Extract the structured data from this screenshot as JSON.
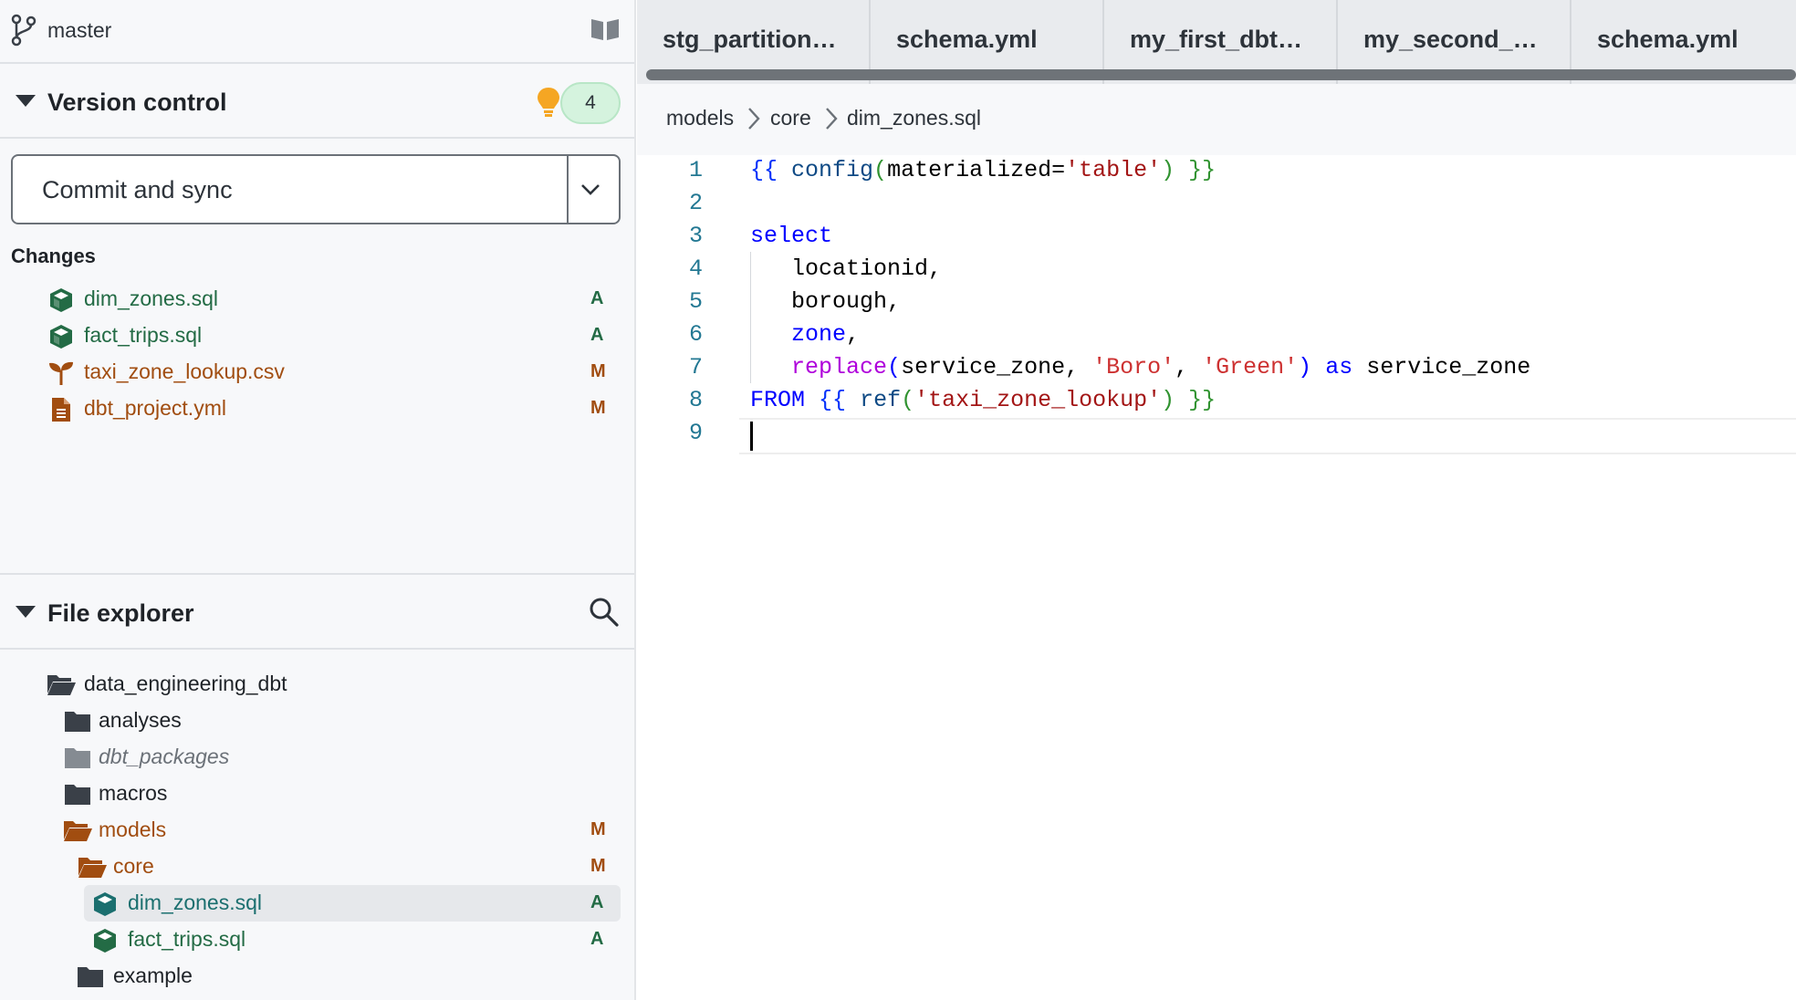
{
  "branch": {
    "name": "master",
    "icon": "git-branch-icon",
    "docs_icon": "book-icon"
  },
  "version_control": {
    "title": "Version control",
    "badge_icon": "lightbulb-icon",
    "badge_count": "4",
    "commit_button": "Commit and sync",
    "changes_label": "Changes",
    "changes": [
      {
        "name": "dim_zones.sql",
        "status": "A",
        "icon": "cube-icon"
      },
      {
        "name": "fact_trips.sql",
        "status": "A",
        "icon": "cube-icon"
      },
      {
        "name": "taxi_zone_lookup.csv",
        "status": "M",
        "icon": "seed-icon"
      },
      {
        "name": "dbt_project.yml",
        "status": "M",
        "icon": "file-icon"
      }
    ]
  },
  "file_explorer": {
    "title": "File explorer",
    "items": [
      {
        "name": "data_engineering_dbt",
        "status": "",
        "icon": "folder-open-icon"
      },
      {
        "name": "analyses",
        "status": "",
        "icon": "folder-icon"
      },
      {
        "name": "dbt_packages",
        "status": "",
        "icon": "folder-icon"
      },
      {
        "name": "macros",
        "status": "",
        "icon": "folder-icon"
      },
      {
        "name": "models",
        "status": "M",
        "icon": "folder-open-icon"
      },
      {
        "name": "core",
        "status": "M",
        "icon": "folder-open-icon"
      },
      {
        "name": "dim_zones.sql",
        "status": "A",
        "icon": "cube-icon"
      },
      {
        "name": "fact_trips.sql",
        "status": "A",
        "icon": "cube-icon"
      },
      {
        "name": "example",
        "status": "",
        "icon": "folder-icon"
      }
    ]
  },
  "tabs": [
    {
      "label": "stg_partition…"
    },
    {
      "label": "schema.yml"
    },
    {
      "label": "my_first_dbt…"
    },
    {
      "label": "my_second_…"
    },
    {
      "label": "schema.yml"
    }
  ],
  "breadcrumb": [
    "models",
    "core",
    "dim_zones.sql"
  ],
  "code": {
    "line_numbers": [
      "1",
      "2",
      "3",
      "4",
      "5",
      "6",
      "7",
      "8",
      "9"
    ],
    "tokens": {
      "l1_open": "{{",
      "l1_config": "config",
      "l1_paren_open": "(",
      "l1_arg": "materialized=",
      "l1_str": "'table'",
      "l1_paren_close": ")",
      "l1_close": "}}",
      "l3_select": "select",
      "l4_text": "locationid,",
      "l5_text": "borough,",
      "l6_zone": "zone",
      "l6_comma": ",",
      "l7_replace": "replace",
      "l7_paren_open": "(",
      "l7_arg": "service_zone, ",
      "l7_str1": "'Boro'",
      "l7_comma": ", ",
      "l7_str2": "'Green'",
      "l7_paren_close": ")",
      "l7_as": "as",
      "l7_alias": "service_zone",
      "l8_from": "FROM",
      "l8_open": "{{",
      "l8_ref": "ref",
      "l8_paren_open": "(",
      "l8_str": "'taxi_zone_lookup'",
      "l8_paren_close": ")",
      "l8_close": "}}"
    }
  }
}
